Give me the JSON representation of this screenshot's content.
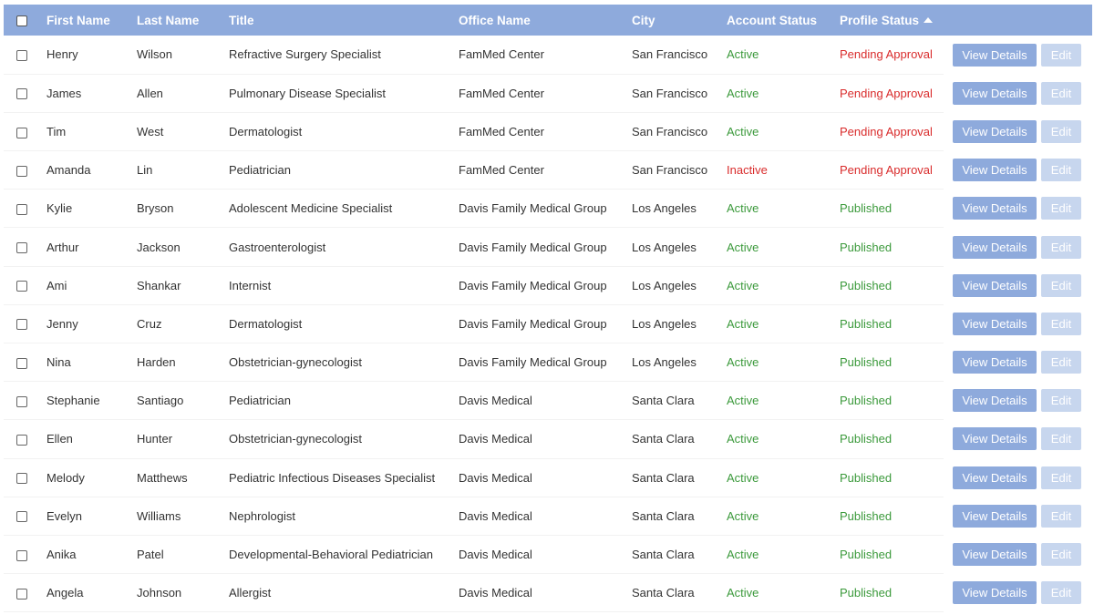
{
  "table": {
    "headers": {
      "first_name": "First Name",
      "last_name": "Last Name",
      "title": "Title",
      "office_name": "Office Name",
      "city": "City",
      "account_status": "Account Status",
      "profile_status": "Profile Status"
    },
    "sort": {
      "column": "profile_status",
      "direction": "ascending",
      "icon": "sort-asc-icon"
    },
    "buttons": {
      "view": "View Details",
      "edit": "Edit"
    },
    "colors": {
      "header_bg": "#8eaadc",
      "active": "#3c9a3c",
      "inactive": "#d92c2c",
      "pending": "#d92c2c",
      "published": "#3c9a3c",
      "edit_disabled": "#c7d6ee"
    },
    "rows": [
      {
        "first": "Henry",
        "last": "Wilson",
        "title": "Refractive Surgery Specialist",
        "office": "FamMed Center",
        "city": "San Francisco",
        "account": "Active",
        "profile": "Pending Approval"
      },
      {
        "first": "James",
        "last": "Allen",
        "title": "Pulmonary Disease Specialist",
        "office": "FamMed Center",
        "city": "San Francisco",
        "account": "Active",
        "profile": "Pending Approval"
      },
      {
        "first": "Tim",
        "last": "West",
        "title": "Dermatologist",
        "office": "FamMed Center",
        "city": "San Francisco",
        "account": "Active",
        "profile": "Pending Approval"
      },
      {
        "first": "Amanda",
        "last": "Lin",
        "title": "Pediatrician",
        "office": "FamMed Center",
        "city": "San Francisco",
        "account": "Inactive",
        "profile": "Pending Approval"
      },
      {
        "first": "Kylie",
        "last": "Bryson",
        "title": "Adolescent Medicine Specialist",
        "office": "Davis Family Medical Group",
        "city": "Los Angeles",
        "account": "Active",
        "profile": "Published"
      },
      {
        "first": "Arthur",
        "last": "Jackson",
        "title": "Gastroenterologist",
        "office": "Davis Family Medical Group",
        "city": "Los Angeles",
        "account": "Active",
        "profile": "Published"
      },
      {
        "first": "Ami",
        "last": "Shankar",
        "title": "Internist",
        "office": "Davis Family Medical Group",
        "city": "Los Angeles",
        "account": "Active",
        "profile": "Published"
      },
      {
        "first": "Jenny",
        "last": "Cruz",
        "title": "Dermatologist",
        "office": "Davis Family Medical Group",
        "city": "Los Angeles",
        "account": "Active",
        "profile": "Published"
      },
      {
        "first": "Nina",
        "last": "Harden",
        "title": "Obstetrician-gynecologist",
        "office": "Davis Family Medical Group",
        "city": "Los Angeles",
        "account": "Active",
        "profile": "Published"
      },
      {
        "first": "Stephanie",
        "last": "Santiago",
        "title": "Pediatrician",
        "office": "Davis Medical",
        "city": "Santa Clara",
        "account": "Active",
        "profile": "Published"
      },
      {
        "first": "Ellen",
        "last": "Hunter",
        "title": "Obstetrician-gynecologist",
        "office": "Davis Medical",
        "city": "Santa Clara",
        "account": "Active",
        "profile": "Published"
      },
      {
        "first": "Melody",
        "last": "Matthews",
        "title": "Pediatric Infectious Diseases Specialist",
        "office": "Davis Medical",
        "city": "Santa Clara",
        "account": "Active",
        "profile": "Published"
      },
      {
        "first": "Evelyn",
        "last": "Williams",
        "title": "Nephrologist",
        "office": "Davis Medical",
        "city": "Santa Clara",
        "account": "Active",
        "profile": "Published"
      },
      {
        "first": "Anika",
        "last": "Patel",
        "title": "Developmental-Behavioral Pediatrician",
        "office": "Davis Medical",
        "city": "Santa Clara",
        "account": "Active",
        "profile": "Published"
      },
      {
        "first": "Angela",
        "last": "Johnson",
        "title": "Allergist",
        "office": "Davis Medical",
        "city": "Santa Clara",
        "account": "Active",
        "profile": "Published"
      }
    ]
  }
}
